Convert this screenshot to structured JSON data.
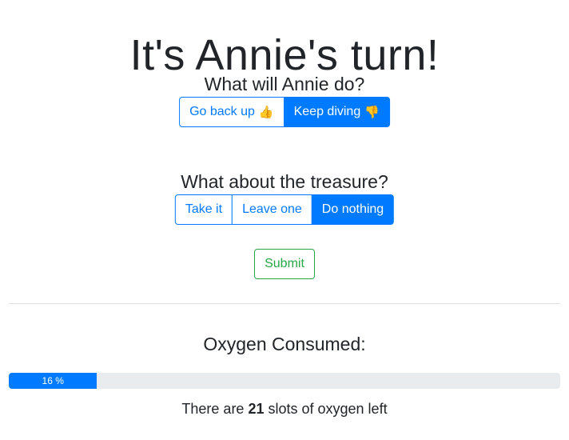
{
  "turn_title": "It's Annie's turn!",
  "action": {
    "question": "What will Annie do?",
    "options": [
      {
        "label": "Go back up",
        "icon": "👍",
        "icon_name": "thumbs-up-icon",
        "active": false
      },
      {
        "label": "Keep diving",
        "icon": "👎",
        "icon_name": "thumbs-down-icon",
        "active": true
      }
    ]
  },
  "treasure": {
    "question": "What about the treasure?",
    "options": [
      {
        "label": "Take it",
        "active": false
      },
      {
        "label": "Leave one",
        "active": false
      },
      {
        "label": "Do nothing",
        "active": true
      }
    ]
  },
  "submit_label": "Submit",
  "oxygen": {
    "label": "Oxygen Consumed:",
    "percent": 16,
    "percent_text": "16 %",
    "slots_prefix": "There are ",
    "slots_left": "21",
    "slots_suffix": " slots of oxygen left"
  },
  "colors": {
    "primary": "#007bff",
    "success": "#28a745",
    "track": "#e9ecef"
  }
}
